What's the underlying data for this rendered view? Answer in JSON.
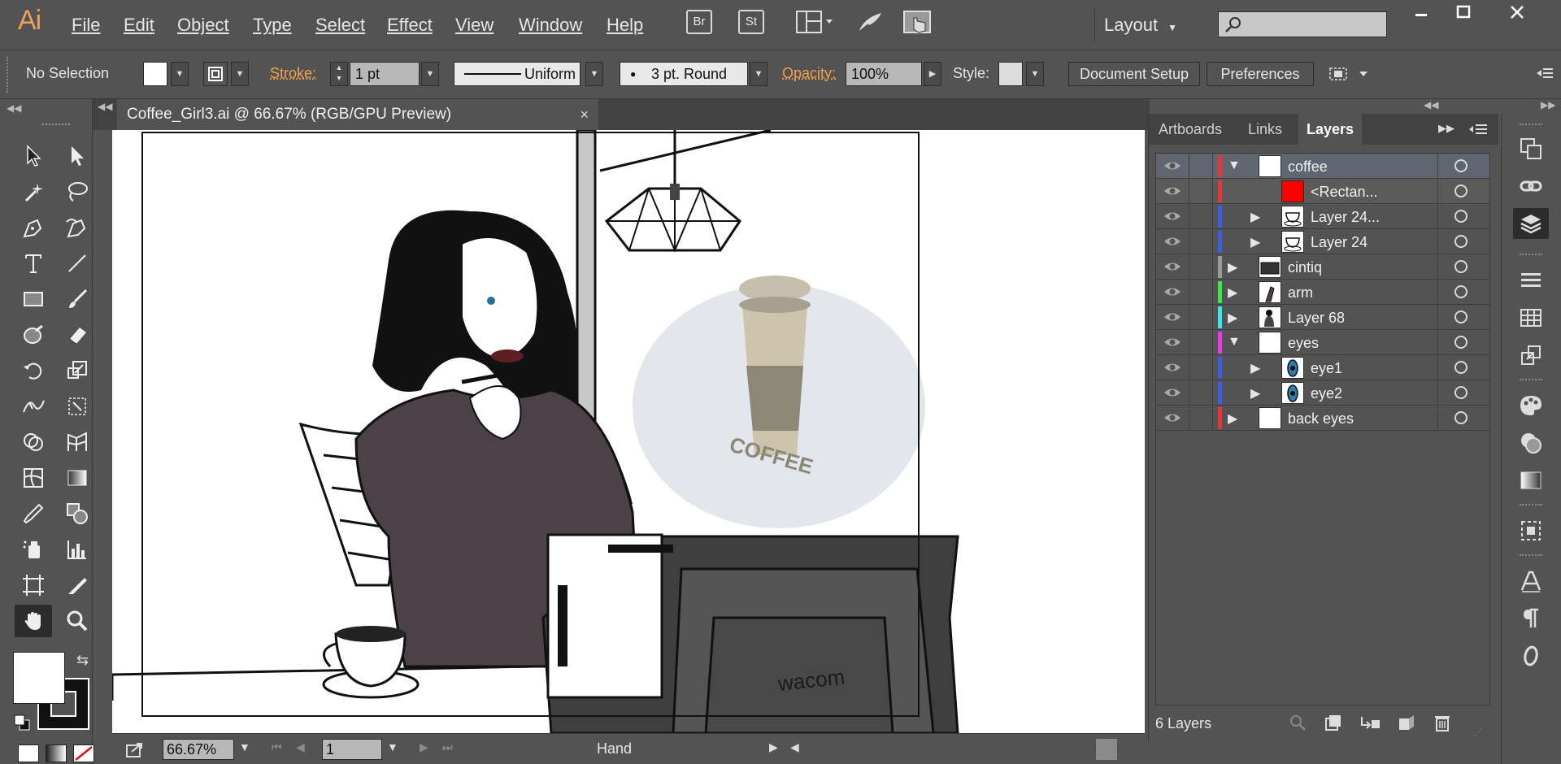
{
  "app": {
    "logo": "Ai"
  },
  "menu": {
    "items": [
      "File",
      "Edit",
      "Object",
      "Type",
      "Select",
      "Effect",
      "View",
      "Window",
      "Help"
    ],
    "bridge": "Br",
    "stock": "St",
    "workspace": "Layout"
  },
  "control": {
    "selection": "No Selection",
    "stroke_label": "Stroke:",
    "stroke_weight": "1 pt",
    "profile": "Uniform",
    "brush": "3 pt. Round",
    "opacity_label": "Opacity:",
    "opacity": "100%",
    "style_label": "Style:",
    "document_setup": "Document Setup",
    "preferences": "Preferences"
  },
  "document": {
    "tab_title": "Coffee_Girl3.ai @ 66.67% (RGB/GPU Preview)",
    "close": "×"
  },
  "statusbar": {
    "zoom": "66.67%",
    "artboard": "1",
    "tool": "Hand"
  },
  "layers_panel": {
    "tabs": [
      "Artboards",
      "Links",
      "Layers"
    ],
    "active_tab": "Layers",
    "rows": [
      {
        "name": "coffee",
        "color": "#e8353a",
        "level": 0,
        "expand": "▼",
        "thumb": "white"
      },
      {
        "name": "<Rectan...",
        "color": "#e8353a",
        "level": 1,
        "expand": "",
        "thumb": "red"
      },
      {
        "name": "Layer 24...",
        "color": "#3c5de8",
        "level": 1,
        "expand": "▶",
        "thumb": "cup"
      },
      {
        "name": "Layer 24",
        "color": "#3c5de8",
        "level": 1,
        "expand": "▶",
        "thumb": "cup"
      },
      {
        "name": "cintiq",
        "color": "#9a9a9a",
        "level": 0,
        "expand": "▶",
        "thumb": "tablet"
      },
      {
        "name": "arm",
        "color": "#3ae84a",
        "level": 0,
        "expand": "▶",
        "thumb": "arm"
      },
      {
        "name": "Layer 68",
        "color": "#3ae8e8",
        "level": 0,
        "expand": "▶",
        "thumb": "figure"
      },
      {
        "name": "eyes",
        "color": "#e83ae8",
        "level": 0,
        "expand": "▼",
        "thumb": "white"
      },
      {
        "name": "eye1",
        "color": "#3c5de8",
        "level": 1,
        "expand": "▶",
        "thumb": "eye"
      },
      {
        "name": "eye2",
        "color": "#3c5de8",
        "level": 1,
        "expand": "▶",
        "thumb": "eye"
      },
      {
        "name": "back eyes",
        "color": "#e8353a",
        "level": 0,
        "expand": "▶",
        "thumb": "white"
      }
    ],
    "count": "6 Layers"
  },
  "artwork": {
    "cup_text": "COFFEE",
    "tablet_brand": "wacom"
  },
  "icons": {
    "tools": [
      "selection-icon",
      "direct-selection-icon",
      "magic-wand-icon",
      "lasso-icon",
      "pen-icon",
      "curvature-icon",
      "type-icon",
      "line-icon",
      "rectangle-icon",
      "paintbrush-icon",
      "shaper-icon",
      "eraser-icon",
      "rotate-icon",
      "scale-icon",
      "width-icon",
      "free-transform-icon",
      "shape-builder-icon",
      "perspective-grid-icon",
      "mesh-icon",
      "gradient-icon",
      "eyedropper-icon",
      "blend-icon",
      "symbol-sprayer-icon",
      "column-graph-icon",
      "artboard-icon",
      "slice-icon",
      "hand-icon",
      "zoom-icon"
    ],
    "dock": [
      "transform-icon",
      "links-icon",
      "layers-icon",
      "align-icon",
      "table-icon",
      "export-icon",
      "color-guide-icon",
      "appearance-icon",
      "gradient-panel-icon",
      "transparency-icon",
      "character-icon",
      "paragraph-icon",
      "opentype-icon"
    ]
  },
  "colors": {
    "ui_bg": "#535353",
    "accent_orange": "#f0a050",
    "selected_row": "#5f6670"
  }
}
